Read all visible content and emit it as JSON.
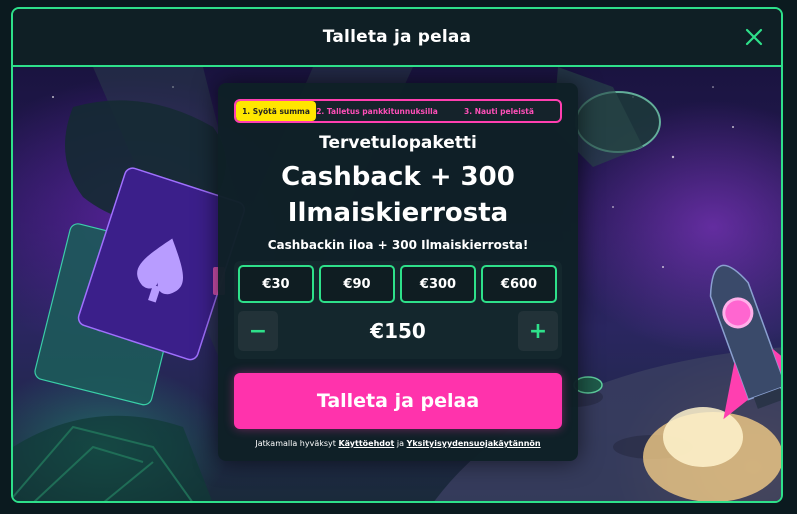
{
  "header": {
    "title": "Talleta ja pelaa"
  },
  "icons": {
    "close": "close-icon",
    "minus": "minus-icon",
    "plus": "plus-icon"
  },
  "colors": {
    "accent": "#2ee08a",
    "cta": "#ff33ac",
    "active_step": "#ffe600",
    "step_text": "#ff4fb8"
  },
  "steps": [
    {
      "label": "1. Syötä summa",
      "active": true
    },
    {
      "label": "2. Talletus pankkitunnuksilla",
      "active": false
    },
    {
      "label": "3. Nauti peleistä",
      "active": false
    }
  ],
  "promo": {
    "title_small": "Tervetulopaketti",
    "title_line1": "Cashback + 300",
    "title_line2": "Ilmaiskierrosta",
    "subtitle": "Cashbackin iloa + 300 Ilmaiskierrosta!"
  },
  "amounts": [
    "€30",
    "€90",
    "€300",
    "€600"
  ],
  "stepper": {
    "value": "€150",
    "minus": "−",
    "plus": "+"
  },
  "cta": {
    "label": "Talleta ja pelaa"
  },
  "terms": {
    "prefix": "Jatkamalla hyväksyt",
    "link1": "Käyttöehdot",
    "middle": "ja",
    "link2": "Yksityisyydensuojakäytännön"
  }
}
